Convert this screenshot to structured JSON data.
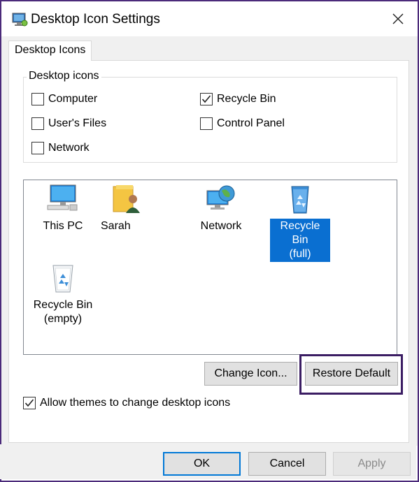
{
  "window": {
    "title": "Desktop Icon Settings",
    "app_icon": "desktop-settings-icon",
    "close_icon": "close-icon"
  },
  "tab": {
    "label": "Desktop Icons"
  },
  "desktop_icons_group": {
    "label": "Desktop icons",
    "options": [
      {
        "label": "Computer",
        "checked": false
      },
      {
        "label": "Recycle Bin",
        "checked": true
      },
      {
        "label": "User's Files",
        "checked": false
      },
      {
        "label": "Control Panel",
        "checked": false
      },
      {
        "label": "Network",
        "checked": false
      }
    ]
  },
  "icon_list": [
    {
      "line1": "This PC",
      "line2": "",
      "icon": "monitor-icon",
      "selected": false
    },
    {
      "line1": "Sarah",
      "line2": "",
      "icon": "user-folder-icon",
      "selected": false
    },
    {
      "line1": "Network",
      "line2": "",
      "icon": "network-globe-icon",
      "selected": false
    },
    {
      "line1": "Recycle Bin",
      "line2": "(full)",
      "icon": "recycle-bin-full-icon",
      "selected": true
    },
    {
      "line1": "Recycle Bin",
      "line2": "(empty)",
      "icon": "recycle-bin-empty-icon",
      "selected": false
    }
  ],
  "buttons": {
    "change_icon": "Change Icon...",
    "restore_default": "Restore Default",
    "ok": "OK",
    "cancel": "Cancel",
    "apply": "Apply"
  },
  "allow_themes": {
    "label": "Allow themes to change desktop icons",
    "checked": true
  },
  "colors": {
    "selection": "#0a6fd1",
    "highlight_border": "#3b1d63",
    "frame_border": "#4b2a7a"
  }
}
